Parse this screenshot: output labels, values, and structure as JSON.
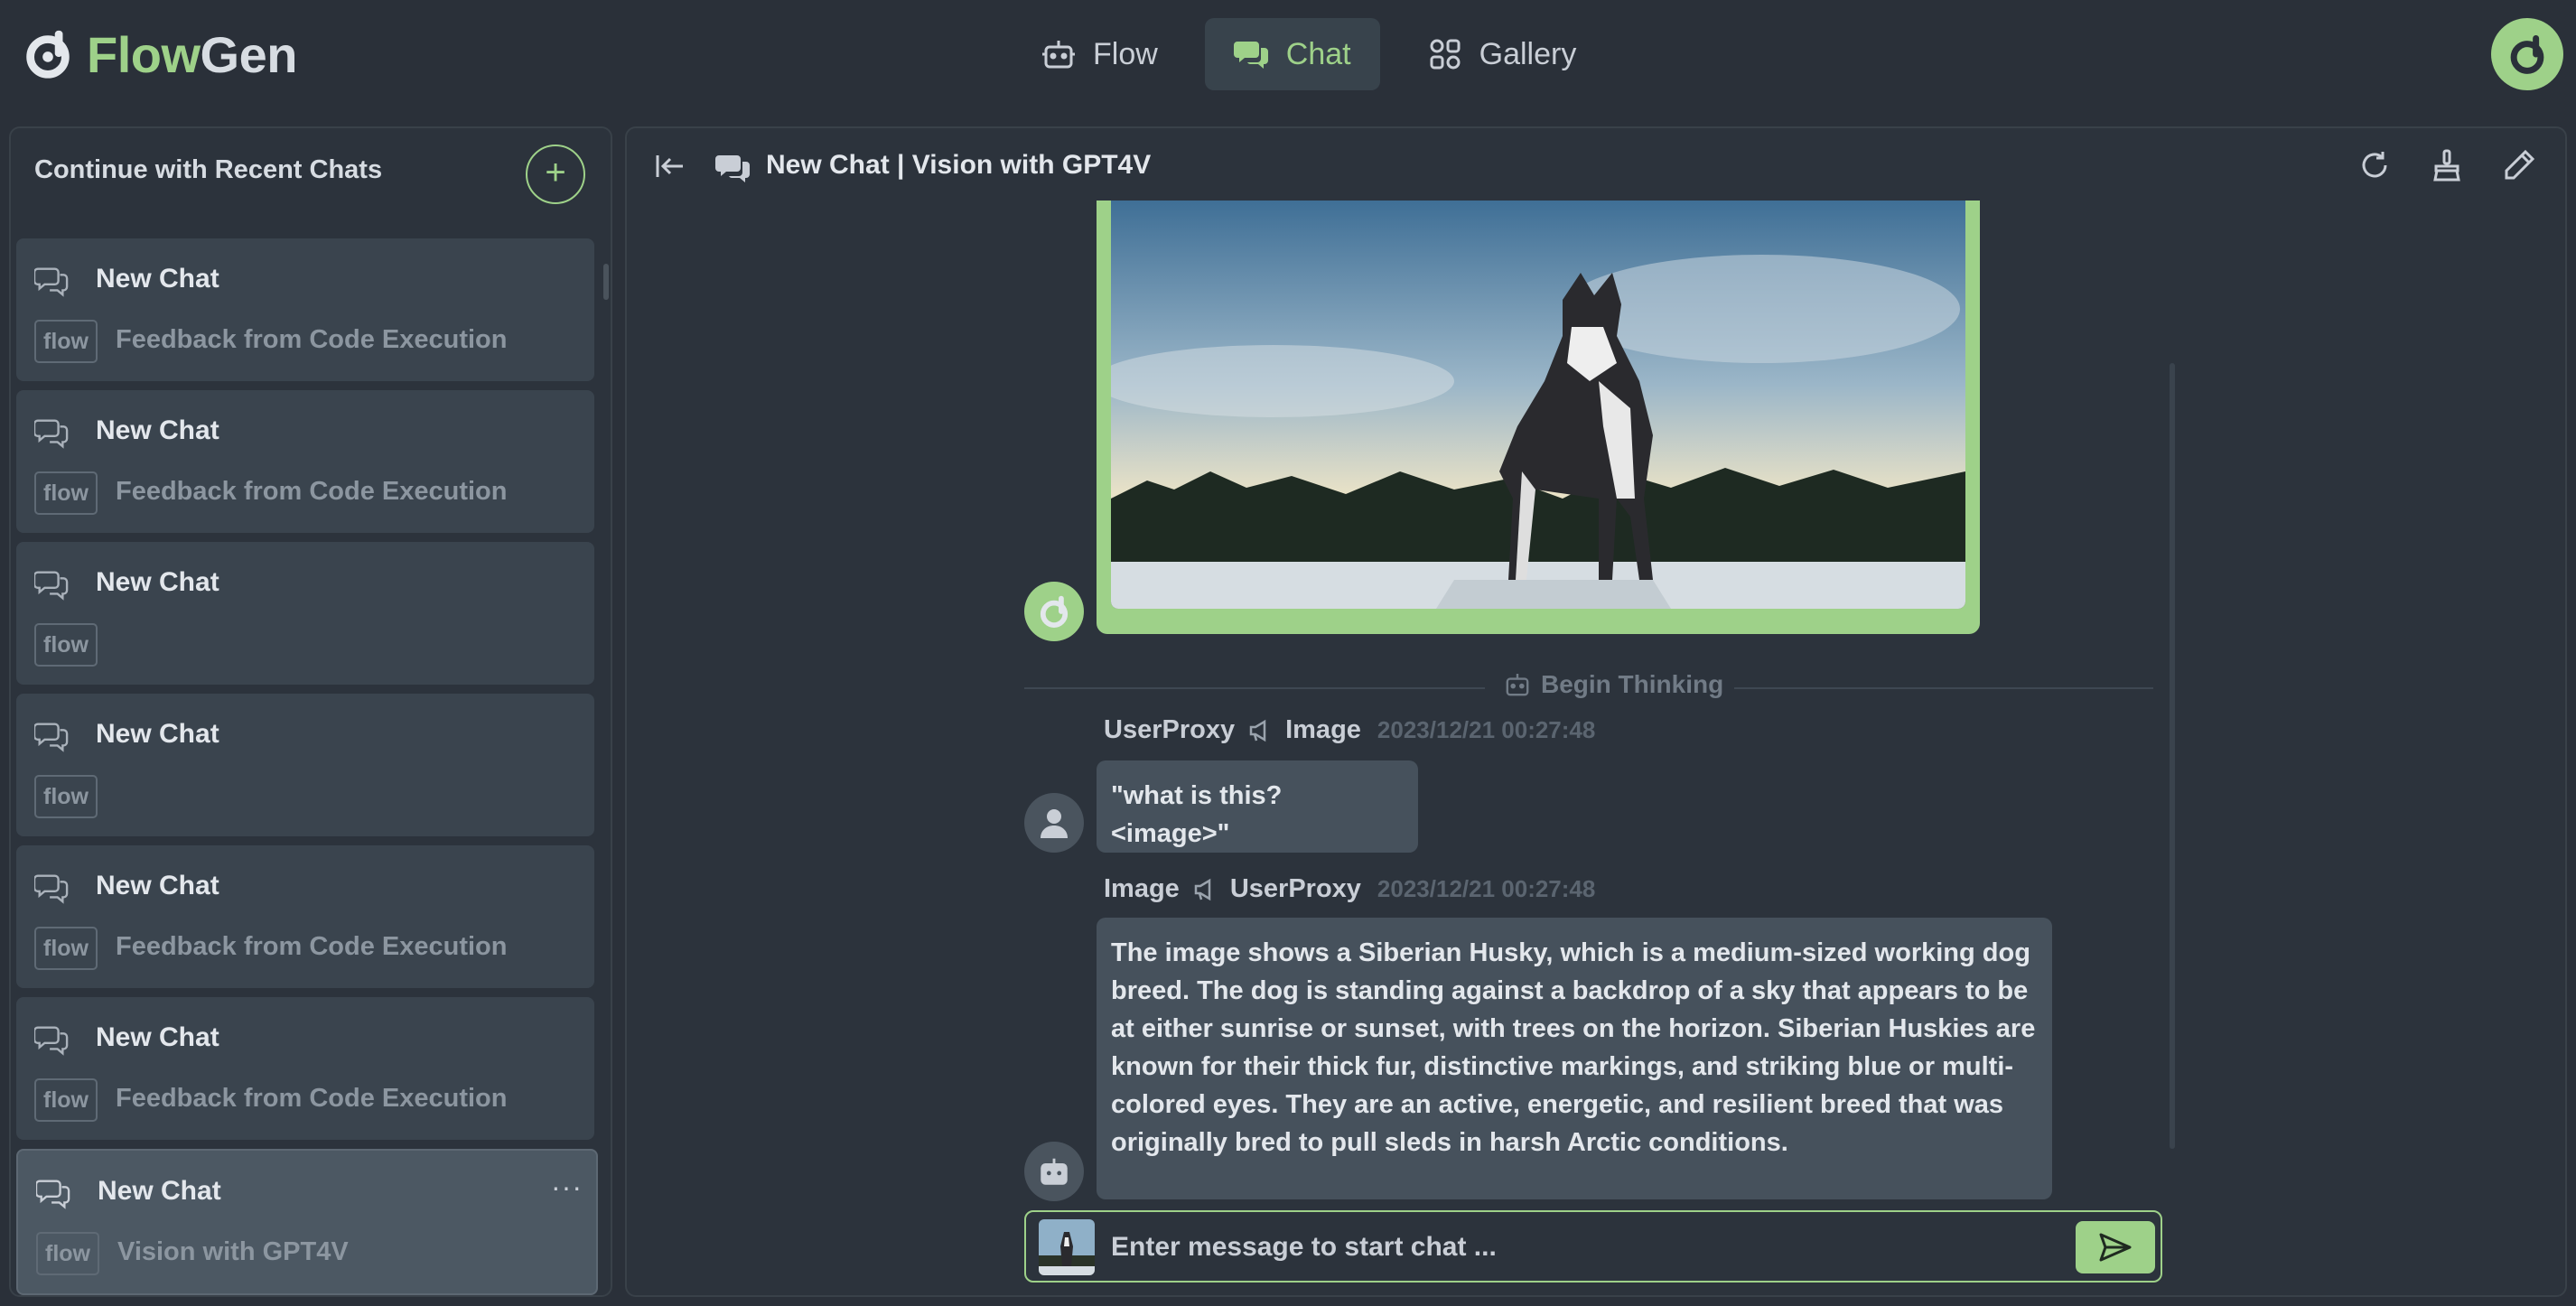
{
  "app": {
    "brand_part1": "Flow",
    "brand_part2": "Gen",
    "accent_color": "#9ed189"
  },
  "nav": {
    "tabs": [
      {
        "label": "Flow",
        "icon": "robot-icon",
        "active": false
      },
      {
        "label": "Chat",
        "icon": "chat-bubbles-icon",
        "active": true
      },
      {
        "label": "Gallery",
        "icon": "grid-icon",
        "active": false
      }
    ]
  },
  "sidebar": {
    "heading": "Continue with Recent Chats",
    "add_label": "+",
    "items": [
      {
        "title": "New Chat",
        "badge": "flow",
        "subtitle": "Feedback from Code Execution"
      },
      {
        "title": "New Chat",
        "badge": "flow",
        "subtitle": "Feedback from Code Execution"
      },
      {
        "title": "New Chat",
        "badge": "flow",
        "subtitle": ""
      },
      {
        "title": "New Chat",
        "badge": "flow",
        "subtitle": ""
      },
      {
        "title": "New Chat",
        "badge": "flow",
        "subtitle": "Feedback from Code Execution"
      },
      {
        "title": "New Chat",
        "badge": "flow",
        "subtitle": "Feedback from Code Execution"
      },
      {
        "title": "New Chat",
        "badge": "flow",
        "subtitle": "Vision with GPT4V",
        "more": "···",
        "active": true
      }
    ]
  },
  "main": {
    "title": "New Chat | Vision with GPT4V",
    "divider_label": "Begin Thinking",
    "messages": [
      {
        "from": "UserProxy",
        "to": "Image",
        "timestamp": "2023/12/21 00:27:48",
        "text": "\"what is this? <image>\""
      },
      {
        "from": "Image",
        "to": "UserProxy",
        "timestamp": "2023/12/21 00:27:48",
        "text": "The image shows a Siberian Husky, which is a medium-sized working dog breed. The dog is standing against a backdrop of a sky that appears to be at either sunrise or sunset, with trees on the horizon. Siberian Huskies are known for their thick fur, distinctive markings, and striking blue or multi-colored eyes. They are an active, energetic, and resilient breed that was originally bred to pull sleds in harsh Arctic conditions."
      }
    ],
    "input_placeholder": "Enter message to start chat ..."
  }
}
